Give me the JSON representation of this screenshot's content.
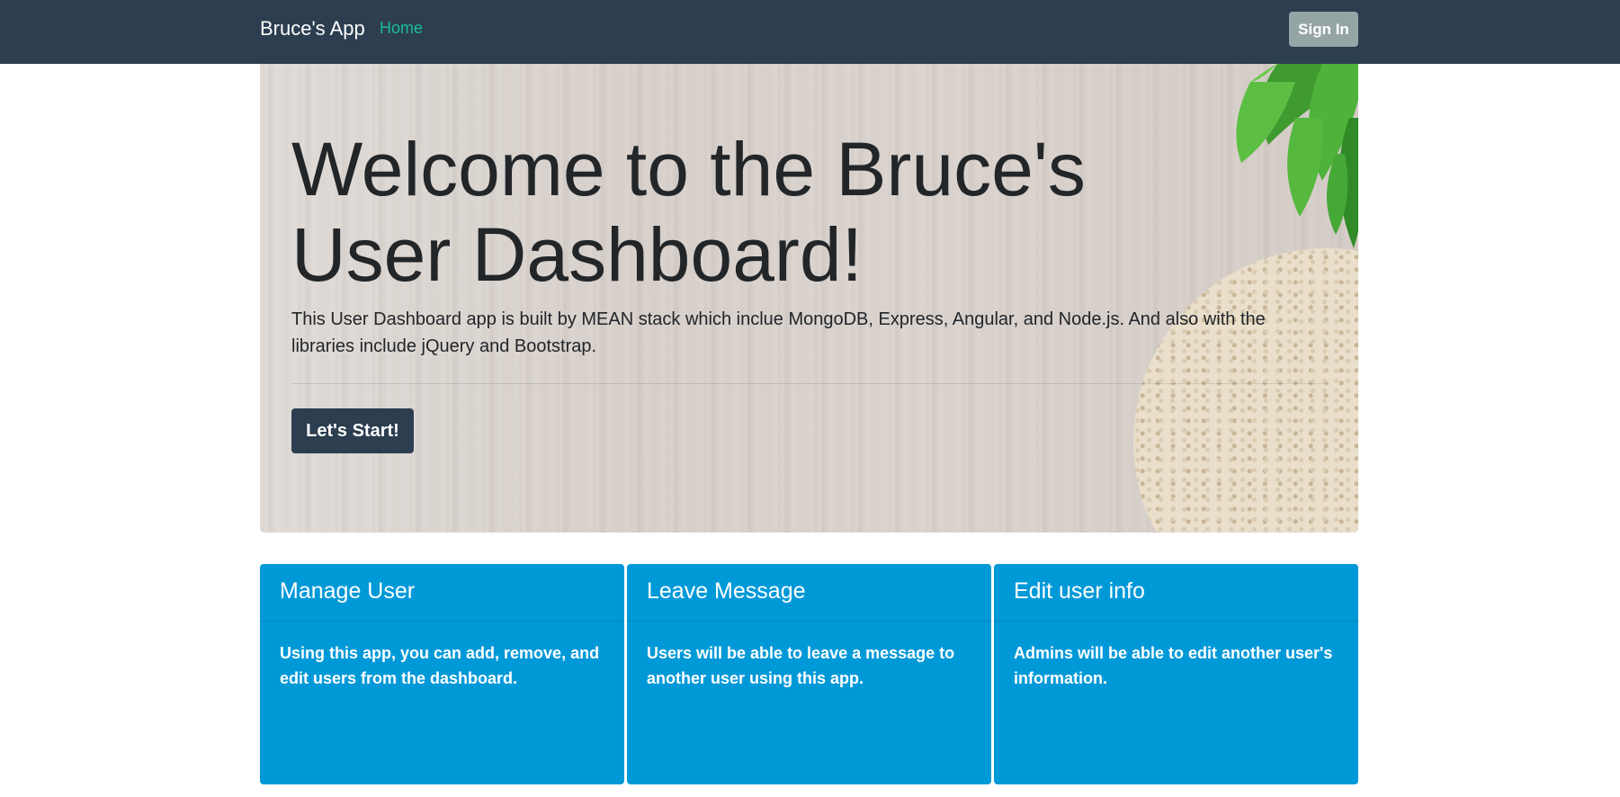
{
  "navbar": {
    "brand": "Bruce's App",
    "home_link": "Home",
    "signin_label": "Sign In",
    "colors": {
      "background": "#2c3e50",
      "active_link": "#18bc9c",
      "signin_bg": "#95a5a6"
    }
  },
  "hero": {
    "title": "Welcome to the Bruce's User Dashboard!",
    "lead": "This User Dashboard app is built by MEAN stack which inclue MongoDB, Express, Angular, and Node.js. And also with the libraries include jQuery and Bootstrap.",
    "button_label": "Let's Start!",
    "background_image": "wooden-table-with-basil-leaves-and-bread"
  },
  "cards": [
    {
      "title": "Manage User",
      "text": "Using this app, you can add, remove, and edit users from the dashboard."
    },
    {
      "title": "Leave Message",
      "text": "Users will be able to leave a message to another user using this app."
    },
    {
      "title": "Edit user info",
      "text": "Admins will be able to edit another user's information."
    }
  ],
  "card_color": "#0099d8"
}
